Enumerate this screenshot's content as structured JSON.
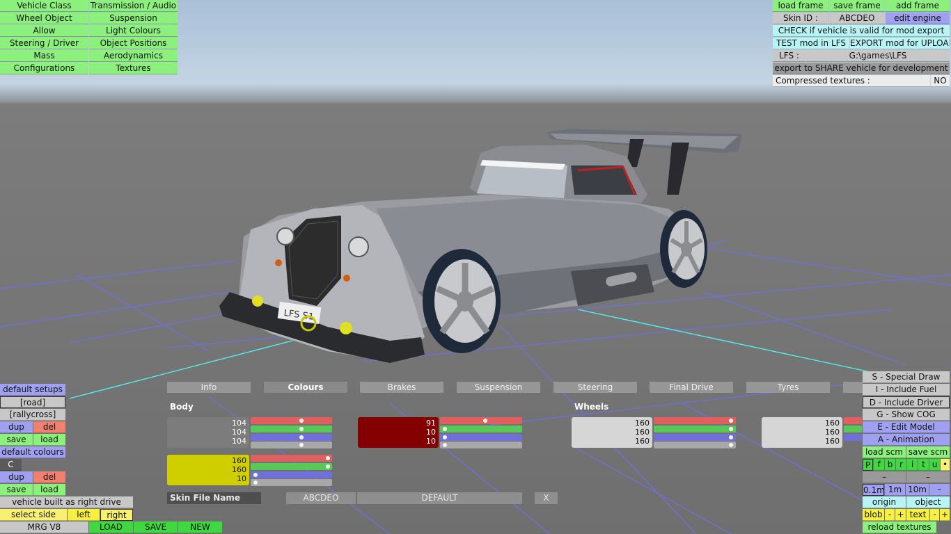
{
  "top_left_menu": [
    [
      "Vehicle Class",
      "Transmission / Audio"
    ],
    [
      "Wheel Object",
      "Suspension"
    ],
    [
      "Allow",
      "Light Colours"
    ],
    [
      "Steering / Driver",
      "Object Positions"
    ],
    [
      "Mass",
      "Aerodynamics"
    ],
    [
      "Configurations",
      "Textures"
    ]
  ],
  "top_right": {
    "load_frame": "load frame",
    "save_frame": "save frame",
    "add_frame": "add frame",
    "skin_id_label": "Skin ID :",
    "skin_id_value": "ABCDEO",
    "edit_engine": "edit engine",
    "check_valid": "CHECK if vehicle is valid for mod export",
    "test_mod": "TEST mod in LFS",
    "export_mod": "EXPORT mod for UPLOAD",
    "lfs_label": "LFS :",
    "lfs_path": "G:\\games\\LFS",
    "export_share": "export to SHARE vehicle for development",
    "compressed_label": "Compressed textures :",
    "compressed_value": "NO"
  },
  "scene": {
    "plate_text": "LFS S1"
  },
  "tabs": [
    "Info",
    "Colours",
    "Brakes",
    "Suspension",
    "Steering",
    "Final Drive",
    "Tyres"
  ],
  "active_tab": "Colours",
  "sections": {
    "body": "Body",
    "wheels": "Wheels"
  },
  "colours": {
    "body1": {
      "r": "104",
      "g": "104",
      "b": "104",
      "hex": "#7c7c7c"
    },
    "body2": {
      "r": "91",
      "g": "10",
      "b": "10",
      "hex": "#840000"
    },
    "body3": {
      "r": "160",
      "g": "160",
      "b": "10",
      "hex": "#cfcf00"
    },
    "wheel1": {
      "r": "160",
      "g": "160",
      "b": "160",
      "hex": "#d6d6d6"
    },
    "wheel2": {
      "r": "160",
      "g": "160",
      "b": "160",
      "hex": "#d6d6d6"
    }
  },
  "skin": {
    "label": "Skin File Name",
    "value": "ABCDEO",
    "default": "DEFAULT",
    "close": "X"
  },
  "left_panel": {
    "default_setups": "default setups",
    "road": "[road]",
    "rallycross": "[rallycross]",
    "dup": "dup",
    "del": "del",
    "save": "save",
    "load": "load",
    "default_colours": "default colours",
    "c": "C",
    "right_drive": "vehicle built as right drive",
    "select_side": "select side",
    "left": "left",
    "right": "right",
    "vehicle_name": "MRG V8",
    "load_btn": "LOAD",
    "save_btn": "SAVE",
    "new_btn": "NEW"
  },
  "right_panel": {
    "special_draw": "S - Special Draw",
    "include_fuel": "I - Include Fuel",
    "include_driver": "D - Include Driver",
    "show_cog": "G - Show COG",
    "edit_model": "E - Edit Model",
    "animation": "A - Animation",
    "load_scm": "load scm",
    "save_scm": "save scm",
    "letters": [
      "P",
      "f",
      "b",
      "r",
      "i",
      "t",
      "u",
      "•"
    ],
    "dash1": "–",
    "dash2": "–",
    "step1": "0.1m",
    "step2": "1m",
    "step3": "10m",
    "step_minus": "–",
    "origin": "origin",
    "object": "object",
    "blob": "blob",
    "minus": "-",
    "plus": "+",
    "text": "text",
    "reload": "reload textures"
  }
}
